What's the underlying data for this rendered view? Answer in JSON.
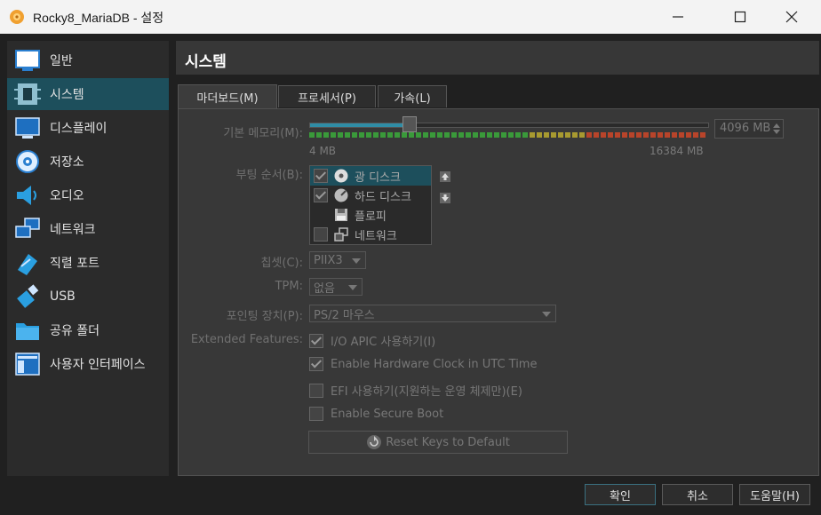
{
  "window": {
    "title": "Rocky8_MariaDB - 설정"
  },
  "sidebar": {
    "items": [
      {
        "label": "일반",
        "icon": "general-monitor-icon"
      },
      {
        "label": "시스템",
        "icon": "chip-icon"
      },
      {
        "label": "디스플레이",
        "icon": "display-icon"
      },
      {
        "label": "저장소",
        "icon": "storage-disk-icon"
      },
      {
        "label": "오디오",
        "icon": "speaker-icon"
      },
      {
        "label": "네트워크",
        "icon": "network-icon"
      },
      {
        "label": "직렬 포트",
        "icon": "serial-port-icon"
      },
      {
        "label": "USB",
        "icon": "usb-icon"
      },
      {
        "label": "공유 폴더",
        "icon": "folder-icon"
      },
      {
        "label": "사용자 인터페이스",
        "icon": "ui-icon"
      }
    ],
    "selected": "시스템"
  },
  "panel": {
    "title": "시스템",
    "tabs": [
      {
        "label": "마더보드(M)"
      },
      {
        "label": "프로세서(P)"
      },
      {
        "label": "가속(L)"
      }
    ],
    "memory": {
      "label": "기본 메모리(M):",
      "value": "4096 MB",
      "min_label": "4 MB",
      "max_label": "16384 MB",
      "fraction": 0.25
    },
    "boot": {
      "label": "부팅 순서(B):",
      "items": [
        {
          "label": "광 디스크",
          "checked": true
        },
        {
          "label": "하드 디스크",
          "checked": true
        },
        {
          "label": "플로피",
          "checked": false
        },
        {
          "label": "네트워크",
          "checked": false
        }
      ]
    },
    "chipset": {
      "label": "칩셋(C):",
      "value": "PIIX3"
    },
    "tpm": {
      "label": "TPM:",
      "value": "없음"
    },
    "pointing": {
      "label": "포인팅 장치(P):",
      "value": "PS/2 마우스"
    },
    "features": {
      "label": "Extended Features:",
      "items": [
        {
          "label": "I/O APIC 사용하기(I)",
          "checked": true
        },
        {
          "label": "Enable Hardware Clock in UTC Time",
          "checked": true
        },
        {
          "label": "EFI 사용하기(지원하는 운영 체제만)(E)",
          "checked": false
        },
        {
          "label": "Enable Secure Boot",
          "checked": false
        }
      ]
    },
    "reset_keys_label": "Reset Keys to Default"
  },
  "buttons": {
    "ok": "확인",
    "cancel": "취소",
    "help": "도움말(H)"
  },
  "colors": {
    "accent": "#1d4f5c",
    "bg": "#202020"
  }
}
